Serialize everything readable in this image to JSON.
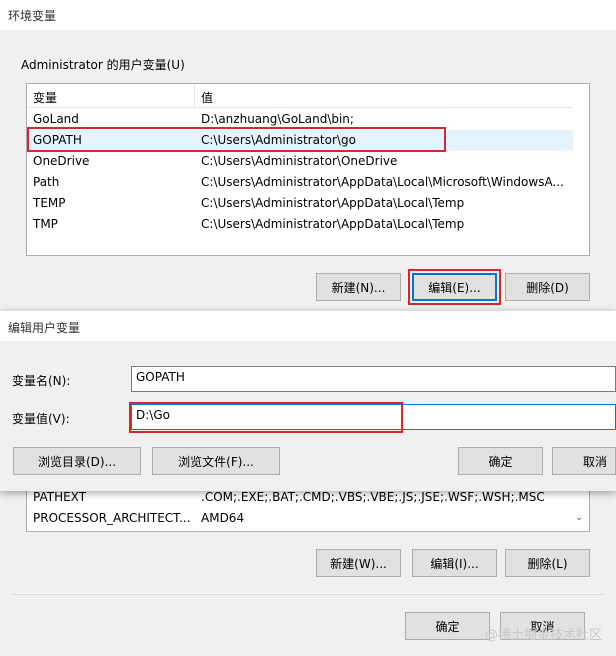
{
  "env_dialog": {
    "title": "环境变量",
    "user_group_label": "Administrator 的用户变量(U)",
    "columns": [
      "变量",
      "值"
    ],
    "user_vars": [
      {
        "name": "GoLand",
        "value": "D:\\anzhuang\\GoLand\\bin;"
      },
      {
        "name": "GOPATH",
        "value": "C:\\Users\\Administrator\\go"
      },
      {
        "name": "OneDrive",
        "value": "C:\\Users\\Administrator\\OneDrive"
      },
      {
        "name": "Path",
        "value": "C:\\Users\\Administrator\\AppData\\Local\\Microsoft\\WindowsA..."
      },
      {
        "name": "TEMP",
        "value": "C:\\Users\\Administrator\\AppData\\Local\\Temp"
      },
      {
        "name": "TMP",
        "value": "C:\\Users\\Administrator\\AppData\\Local\\Temp"
      }
    ],
    "selected_user_var": "GOPATH",
    "user_buttons": {
      "new": "新建(N)...",
      "edit": "编辑(E)...",
      "delete": "删除(D)"
    },
    "system_vars_visible": [
      {
        "name": "PATHEXT",
        "value": ".COM;.EXE;.BAT;.CMD;.VBS;.VBE;.JS;.JSE;.WSF;.WSH;.MSC"
      },
      {
        "name": "PROCESSOR_ARCHITECT...",
        "value": "AMD64"
      }
    ],
    "system_buttons": {
      "new": "新建(W)...",
      "edit": "编辑(I)...",
      "delete": "删除(L)"
    },
    "footer_buttons": {
      "ok": "确定",
      "cancel": "取消"
    }
  },
  "edit_dialog": {
    "title": "编辑用户变量",
    "name_label": "变量名(N):",
    "name_value": "GOPATH",
    "value_label": "变量值(V):",
    "value_value": "D:\\Go",
    "browse_dir": "浏览目录(D)...",
    "browse_file": "浏览文件(F)...",
    "ok": "确定",
    "cancel": "取消"
  },
  "watermark": "@稀土掘金技术社区",
  "colors": {
    "highlight_box": "#d9262c",
    "selection": "#e5f3ff",
    "accent": "#0078d7"
  }
}
